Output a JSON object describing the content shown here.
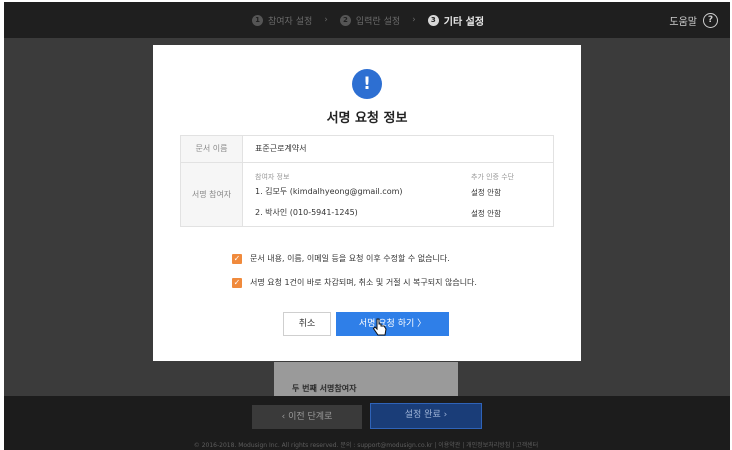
{
  "steps": [
    {
      "num": "1",
      "label": "참여자 설정"
    },
    {
      "num": "2",
      "label": "입력란 설정"
    },
    {
      "num": "3",
      "label": "기타 설정"
    }
  ],
  "help": {
    "label": "도움말",
    "icon": "?"
  },
  "modal": {
    "icon": "!",
    "title": "서명 요청 정보",
    "doc_label": "문서 이름",
    "doc_name": "표준근로계약서",
    "participants_label": "서명 참여자",
    "participants_header": "참여자 정보",
    "auth_header": "추가 인증 수단",
    "participants": [
      {
        "name": "1. 김모두 (kimdalhyeong@gmail.com)",
        "auth": "설정 안함"
      },
      {
        "name": "2. 박사인 (010-5941-1245)",
        "auth": "설정 안함"
      }
    ],
    "checks": [
      "문서 내용, 이름, 이메일 등을 요청 이후 수정할 수 없습니다.",
      "서명 요청 1건이 바로 차감되며, 취소 및 거절 시 복구되지 않습니다."
    ],
    "cancel_label": "취소",
    "request_label": "서명 요청 하기 〉"
  },
  "background": {
    "doc_label": "두 번째 서명참여자"
  },
  "bottom": {
    "prev_label": "‹ 이전 단계로",
    "done_label": "설정 완료 ›",
    "footer": "© 2016-2018. Modusign Inc. All rights reserved.  문의 : support@modusign.co.kr  |  이용약관  |  개인정보처리방침  |  고객센터"
  },
  "colors": {
    "accent": "#2f7fe8",
    "checkbox": "#f08a3c",
    "overlay": "#3b3b3b"
  }
}
